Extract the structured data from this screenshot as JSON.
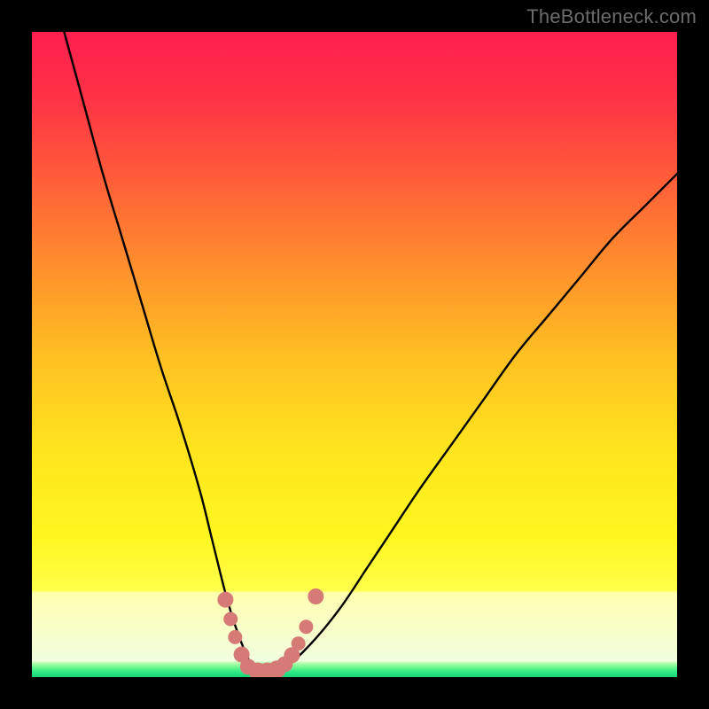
{
  "watermark": {
    "text": "TheBottleneck.com"
  },
  "chart_data": {
    "type": "line",
    "title": "",
    "xlabel": "",
    "ylabel": "",
    "xlim": [
      0,
      100
    ],
    "ylim": [
      0,
      100
    ],
    "grid": false,
    "legend": false,
    "series": [
      {
        "name": "bottleneck-curve",
        "x": [
          5,
          8,
          11,
          14,
          17,
          20,
          23,
          26,
          28,
          30,
          31.5,
          33,
          34,
          35,
          36,
          38,
          40,
          44,
          48,
          52,
          56,
          60,
          65,
          70,
          75,
          80,
          85,
          90,
          95,
          100
        ],
        "values": [
          100,
          89,
          78,
          68,
          58,
          48,
          39,
          29,
          21,
          13,
          8,
          4,
          2,
          0.8,
          0.8,
          0.8,
          2,
          6,
          11,
          17,
          23,
          29,
          36,
          43,
          50,
          56,
          62,
          68,
          73,
          78
        ]
      }
    ],
    "green_band": {
      "y_min": 0,
      "y_max": 2.2
    },
    "pale_band": {
      "y_min": 2.2,
      "y_max": 13
    },
    "markers": {
      "name": "highlight-points",
      "color": "#d67a76",
      "points": [
        {
          "x": 30.0,
          "y": 12.0,
          "r": 9
        },
        {
          "x": 30.8,
          "y": 9.0,
          "r": 8
        },
        {
          "x": 31.5,
          "y": 6.2,
          "r": 8
        },
        {
          "x": 32.5,
          "y": 3.5,
          "r": 9
        },
        {
          "x": 33.5,
          "y": 1.6,
          "r": 9
        },
        {
          "x": 35.0,
          "y": 0.9,
          "r": 10
        },
        {
          "x": 36.5,
          "y": 0.9,
          "r": 10
        },
        {
          "x": 38.0,
          "y": 1.2,
          "r": 10
        },
        {
          "x": 39.2,
          "y": 2.0,
          "r": 9
        },
        {
          "x": 40.3,
          "y": 3.4,
          "r": 9
        },
        {
          "x": 41.3,
          "y": 5.2,
          "r": 8
        },
        {
          "x": 42.5,
          "y": 7.8,
          "r": 8
        },
        {
          "x": 44.0,
          "y": 12.5,
          "r": 9
        }
      ]
    },
    "gradient_stops": [
      {
        "offset": 0.0,
        "color": "#ff1f4f"
      },
      {
        "offset": 0.1,
        "color": "#ff3246"
      },
      {
        "offset": 0.22,
        "color": "#ff5a3a"
      },
      {
        "offset": 0.35,
        "color": "#ff8a2e"
      },
      {
        "offset": 0.5,
        "color": "#ffbf22"
      },
      {
        "offset": 0.65,
        "color": "#ffe51e"
      },
      {
        "offset": 0.78,
        "color": "#fff61f"
      },
      {
        "offset": 0.865,
        "color": "#ffff4a"
      },
      {
        "offset": 0.87,
        "color": "#ffffb0"
      },
      {
        "offset": 0.975,
        "color": "#f2ffe0"
      },
      {
        "offset": 0.978,
        "color": "#b8ffb0"
      },
      {
        "offset": 0.985,
        "color": "#6cf98e"
      },
      {
        "offset": 0.992,
        "color": "#2fe885"
      },
      {
        "offset": 1.0,
        "color": "#16d47a"
      }
    ]
  }
}
